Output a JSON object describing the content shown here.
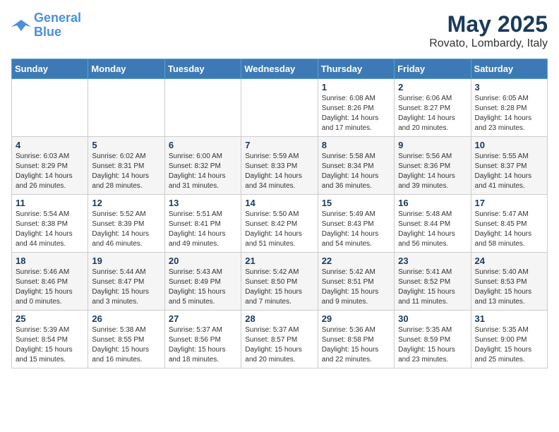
{
  "logo": {
    "line1": "General",
    "line2": "Blue"
  },
  "title": "May 2025",
  "location": "Rovato, Lombardy, Italy",
  "weekdays": [
    "Sunday",
    "Monday",
    "Tuesday",
    "Wednesday",
    "Thursday",
    "Friday",
    "Saturday"
  ],
  "weeks": [
    [
      {
        "day": "",
        "sunrise": "",
        "sunset": "",
        "daylight": ""
      },
      {
        "day": "",
        "sunrise": "",
        "sunset": "",
        "daylight": ""
      },
      {
        "day": "",
        "sunrise": "",
        "sunset": "",
        "daylight": ""
      },
      {
        "day": "",
        "sunrise": "",
        "sunset": "",
        "daylight": ""
      },
      {
        "day": "1",
        "sunrise": "Sunrise: 6:08 AM",
        "sunset": "Sunset: 8:26 PM",
        "daylight": "Daylight: 14 hours and 17 minutes."
      },
      {
        "day": "2",
        "sunrise": "Sunrise: 6:06 AM",
        "sunset": "Sunset: 8:27 PM",
        "daylight": "Daylight: 14 hours and 20 minutes."
      },
      {
        "day": "3",
        "sunrise": "Sunrise: 6:05 AM",
        "sunset": "Sunset: 8:28 PM",
        "daylight": "Daylight: 14 hours and 23 minutes."
      }
    ],
    [
      {
        "day": "4",
        "sunrise": "Sunrise: 6:03 AM",
        "sunset": "Sunset: 8:29 PM",
        "daylight": "Daylight: 14 hours and 26 minutes."
      },
      {
        "day": "5",
        "sunrise": "Sunrise: 6:02 AM",
        "sunset": "Sunset: 8:31 PM",
        "daylight": "Daylight: 14 hours and 28 minutes."
      },
      {
        "day": "6",
        "sunrise": "Sunrise: 6:00 AM",
        "sunset": "Sunset: 8:32 PM",
        "daylight": "Daylight: 14 hours and 31 minutes."
      },
      {
        "day": "7",
        "sunrise": "Sunrise: 5:59 AM",
        "sunset": "Sunset: 8:33 PM",
        "daylight": "Daylight: 14 hours and 34 minutes."
      },
      {
        "day": "8",
        "sunrise": "Sunrise: 5:58 AM",
        "sunset": "Sunset: 8:34 PM",
        "daylight": "Daylight: 14 hours and 36 minutes."
      },
      {
        "day": "9",
        "sunrise": "Sunrise: 5:56 AM",
        "sunset": "Sunset: 8:36 PM",
        "daylight": "Daylight: 14 hours and 39 minutes."
      },
      {
        "day": "10",
        "sunrise": "Sunrise: 5:55 AM",
        "sunset": "Sunset: 8:37 PM",
        "daylight": "Daylight: 14 hours and 41 minutes."
      }
    ],
    [
      {
        "day": "11",
        "sunrise": "Sunrise: 5:54 AM",
        "sunset": "Sunset: 8:38 PM",
        "daylight": "Daylight: 14 hours and 44 minutes."
      },
      {
        "day": "12",
        "sunrise": "Sunrise: 5:52 AM",
        "sunset": "Sunset: 8:39 PM",
        "daylight": "Daylight: 14 hours and 46 minutes."
      },
      {
        "day": "13",
        "sunrise": "Sunrise: 5:51 AM",
        "sunset": "Sunset: 8:41 PM",
        "daylight": "Daylight: 14 hours and 49 minutes."
      },
      {
        "day": "14",
        "sunrise": "Sunrise: 5:50 AM",
        "sunset": "Sunset: 8:42 PM",
        "daylight": "Daylight: 14 hours and 51 minutes."
      },
      {
        "day": "15",
        "sunrise": "Sunrise: 5:49 AM",
        "sunset": "Sunset: 8:43 PM",
        "daylight": "Daylight: 14 hours and 54 minutes."
      },
      {
        "day": "16",
        "sunrise": "Sunrise: 5:48 AM",
        "sunset": "Sunset: 8:44 PM",
        "daylight": "Daylight: 14 hours and 56 minutes."
      },
      {
        "day": "17",
        "sunrise": "Sunrise: 5:47 AM",
        "sunset": "Sunset: 8:45 PM",
        "daylight": "Daylight: 14 hours and 58 minutes."
      }
    ],
    [
      {
        "day": "18",
        "sunrise": "Sunrise: 5:46 AM",
        "sunset": "Sunset: 8:46 PM",
        "daylight": "Daylight: 15 hours and 0 minutes."
      },
      {
        "day": "19",
        "sunrise": "Sunrise: 5:44 AM",
        "sunset": "Sunset: 8:47 PM",
        "daylight": "Daylight: 15 hours and 3 minutes."
      },
      {
        "day": "20",
        "sunrise": "Sunrise: 5:43 AM",
        "sunset": "Sunset: 8:49 PM",
        "daylight": "Daylight: 15 hours and 5 minutes."
      },
      {
        "day": "21",
        "sunrise": "Sunrise: 5:42 AM",
        "sunset": "Sunset: 8:50 PM",
        "daylight": "Daylight: 15 hours and 7 minutes."
      },
      {
        "day": "22",
        "sunrise": "Sunrise: 5:42 AM",
        "sunset": "Sunset: 8:51 PM",
        "daylight": "Daylight: 15 hours and 9 minutes."
      },
      {
        "day": "23",
        "sunrise": "Sunrise: 5:41 AM",
        "sunset": "Sunset: 8:52 PM",
        "daylight": "Daylight: 15 hours and 11 minutes."
      },
      {
        "day": "24",
        "sunrise": "Sunrise: 5:40 AM",
        "sunset": "Sunset: 8:53 PM",
        "daylight": "Daylight: 15 hours and 13 minutes."
      }
    ],
    [
      {
        "day": "25",
        "sunrise": "Sunrise: 5:39 AM",
        "sunset": "Sunset: 8:54 PM",
        "daylight": "Daylight: 15 hours and 15 minutes."
      },
      {
        "day": "26",
        "sunrise": "Sunrise: 5:38 AM",
        "sunset": "Sunset: 8:55 PM",
        "daylight": "Daylight: 15 hours and 16 minutes."
      },
      {
        "day": "27",
        "sunrise": "Sunrise: 5:37 AM",
        "sunset": "Sunset: 8:56 PM",
        "daylight": "Daylight: 15 hours and 18 minutes."
      },
      {
        "day": "28",
        "sunrise": "Sunrise: 5:37 AM",
        "sunset": "Sunset: 8:57 PM",
        "daylight": "Daylight: 15 hours and 20 minutes."
      },
      {
        "day": "29",
        "sunrise": "Sunrise: 5:36 AM",
        "sunset": "Sunset: 8:58 PM",
        "daylight": "Daylight: 15 hours and 22 minutes."
      },
      {
        "day": "30",
        "sunrise": "Sunrise: 5:35 AM",
        "sunset": "Sunset: 8:59 PM",
        "daylight": "Daylight: 15 hours and 23 minutes."
      },
      {
        "day": "31",
        "sunrise": "Sunrise: 5:35 AM",
        "sunset": "Sunset: 9:00 PM",
        "daylight": "Daylight: 15 hours and 25 minutes."
      }
    ]
  ]
}
